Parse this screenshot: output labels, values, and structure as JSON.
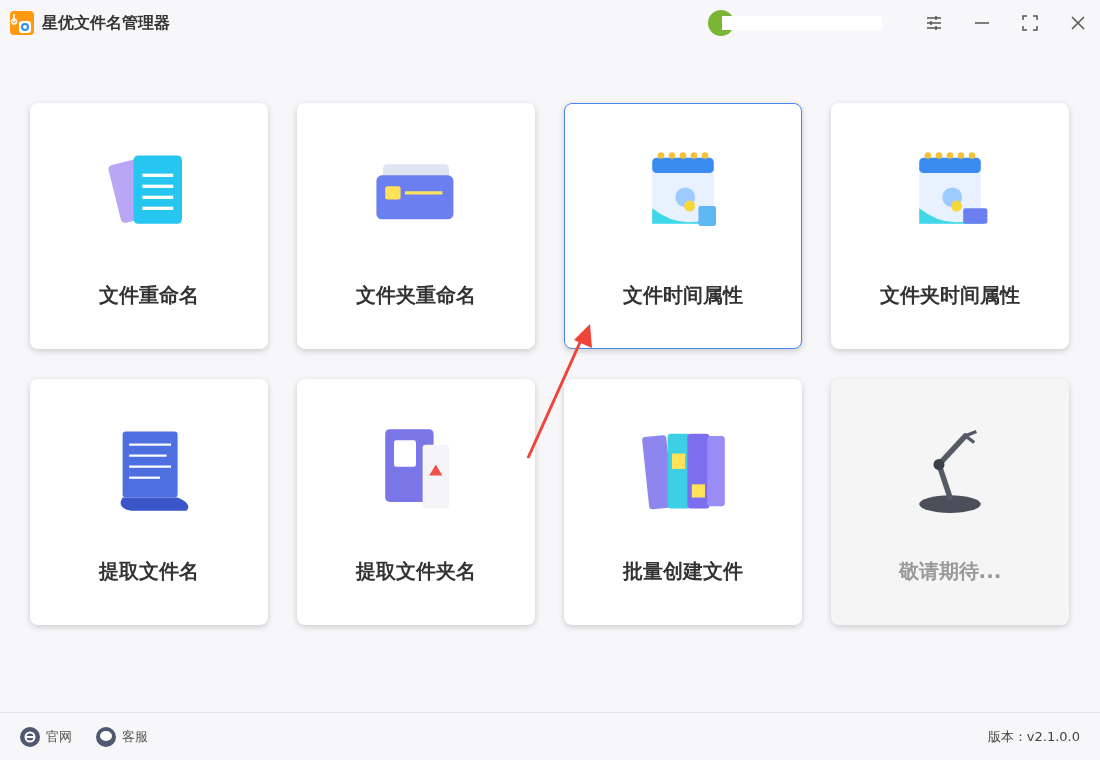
{
  "window": {
    "title": "星优文件名管理器"
  },
  "cards": [
    {
      "label": "文件重命名",
      "selected": false,
      "disabled": false
    },
    {
      "label": "文件夹重命名",
      "selected": false,
      "disabled": false
    },
    {
      "label": "文件时间属性",
      "selected": true,
      "disabled": false
    },
    {
      "label": "文件夹时间属性",
      "selected": false,
      "disabled": false
    },
    {
      "label": "提取文件名",
      "selected": false,
      "disabled": false
    },
    {
      "label": "提取文件夹名",
      "selected": false,
      "disabled": false
    },
    {
      "label": "批量创建文件",
      "selected": false,
      "disabled": false
    },
    {
      "label": "敬请期待...",
      "selected": false,
      "disabled": true
    }
  ],
  "footer": {
    "links": [
      {
        "label": "官网"
      },
      {
        "label": "客服"
      }
    ],
    "version": "版本：v2.1.0.0"
  }
}
